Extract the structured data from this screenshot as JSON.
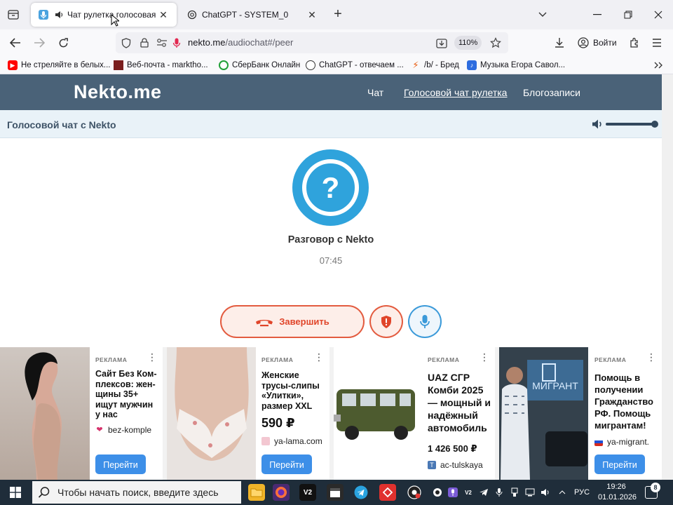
{
  "browser": {
    "tabs": [
      {
        "title": "Чат рулетка голосовая —",
        "active": true
      },
      {
        "title": "ChatGPT - SYSTEM_0",
        "active": false
      }
    ],
    "url_host": "nekto.me",
    "url_path": "/audiochat#/peer",
    "zoom": "110%",
    "signin_label": "Войти",
    "bookmarks": [
      "Не стреляйте в белых...",
      "Веб-почта - marktho...",
      "СберБанк Онлайн",
      "ChatGPT - отвечаем ...",
      "/b/ - Бред",
      "Музыка Егора Савол..."
    ]
  },
  "site": {
    "logo": "Nekto.me",
    "nav": [
      "Чат",
      "Голосовой чат рулетка",
      "Блогозаписи"
    ],
    "subheader_title": "Голосовой чат с Nekto",
    "volume_level": 1.0,
    "avatar_symbol": "?",
    "conversation_title": "Разговор с Nekto",
    "timer": "07:45",
    "end_button_label": "Завершить",
    "colors": {
      "header": "#4a6278",
      "accent_blue": "#2fa3dc",
      "danger": "#e35b3f"
    }
  },
  "ads": [
    {
      "label": "РЕКЛАМА",
      "title": "Сайт Без Ком-плексов: жен-щины 35+ ищут мужчин у нас",
      "domain": "bez-komple",
      "button": "Перейти"
    },
    {
      "label": "РЕКЛАМА",
      "title": "Женские трусы-слипы «Улитки», размер XXL",
      "price": "590 ₽",
      "domain": "ya-lama.com",
      "button": "Перейти"
    },
    {
      "label": "РЕКЛАМА",
      "title": "UAZ СГР Комби 2025 — мощный и надёжный автомобиль",
      "price": "1 426 500 ₽",
      "domain": "ac-tulskaya",
      "button": ""
    },
    {
      "label": "РЕКЛАМА",
      "title": "Помощь в получении Гражданство РФ. Помощь мигрантам!",
      "domain": "ya-migrant.",
      "button": "Перейти",
      "image_text": "МИГРАНТ"
    }
  ],
  "taskbar": {
    "search_placeholder": "Чтобы начать поиск, введите здесь",
    "apps": [
      "V2",
      "V2"
    ],
    "lang": "РУС",
    "time": "19:26",
    "date": "01.01.2026",
    "notifications": "8"
  }
}
